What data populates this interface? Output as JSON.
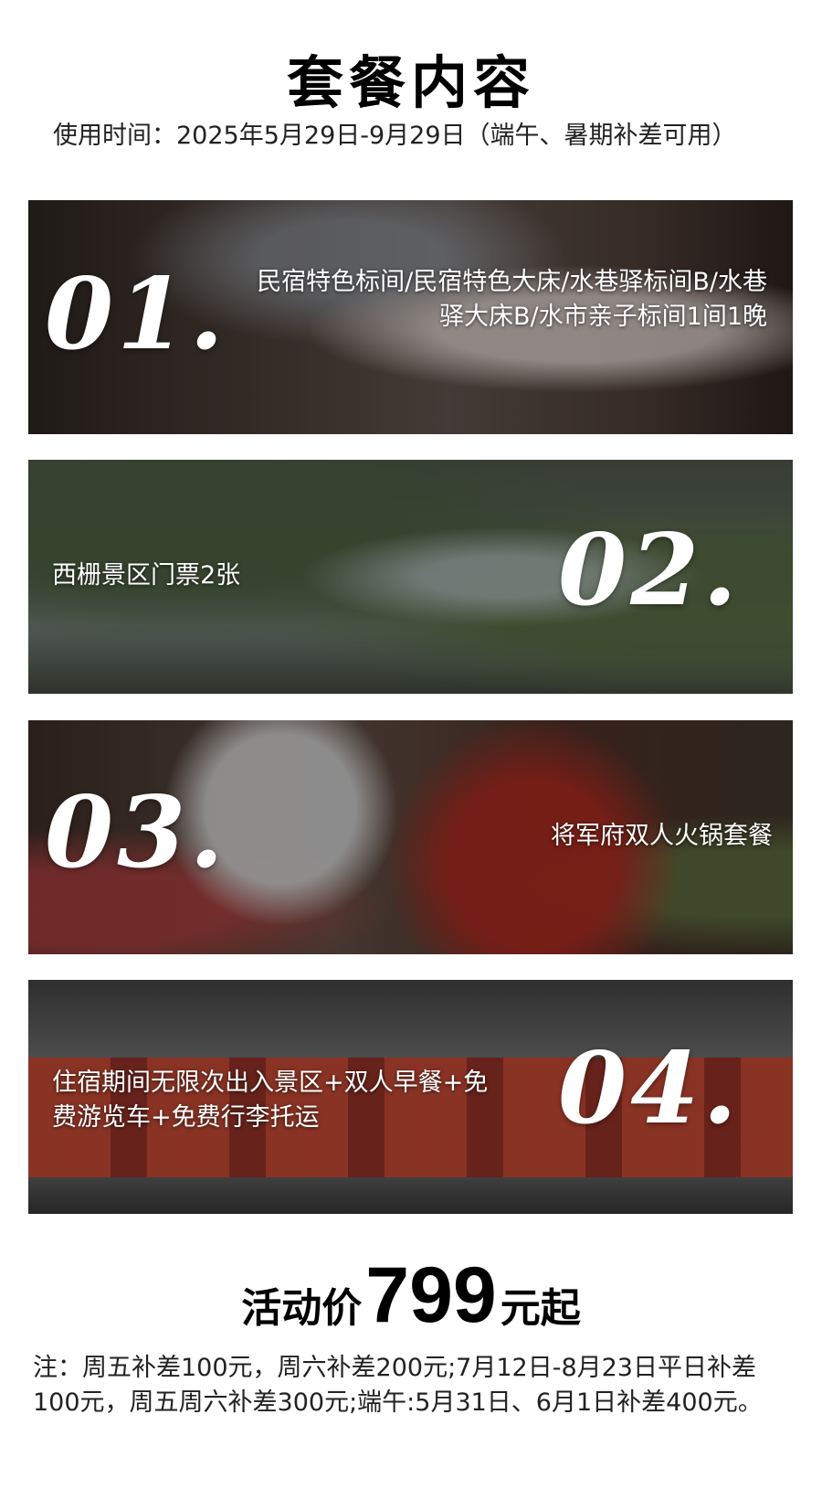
{
  "header": {
    "title": "套餐内容",
    "subtitle": "使用时间：2025年5月29日-9月29日（端午、暑期补差可用）"
  },
  "items": [
    {
      "number": "01.",
      "text": "民宿特色标间/民宿特色大床/水巷驿标间B/水巷驿大床B/水市亲子标间1间1晚"
    },
    {
      "number": "02.",
      "text": "西栅景区门票2张"
    },
    {
      "number": "03.",
      "text": "将军府双人火锅套餐"
    },
    {
      "number": "04.",
      "text": "住宿期间无限次出入景区+双人早餐+免费游览车+免费行李托运"
    }
  ],
  "price": {
    "prefix": "活动价",
    "value": "799",
    "suffix": "元起"
  },
  "note": "注：周五补差100元，周六补差200元;7月12日-8月23日平日补差100元，周五周六补差300元;端午:5月31日、6月1日补差400元。"
}
